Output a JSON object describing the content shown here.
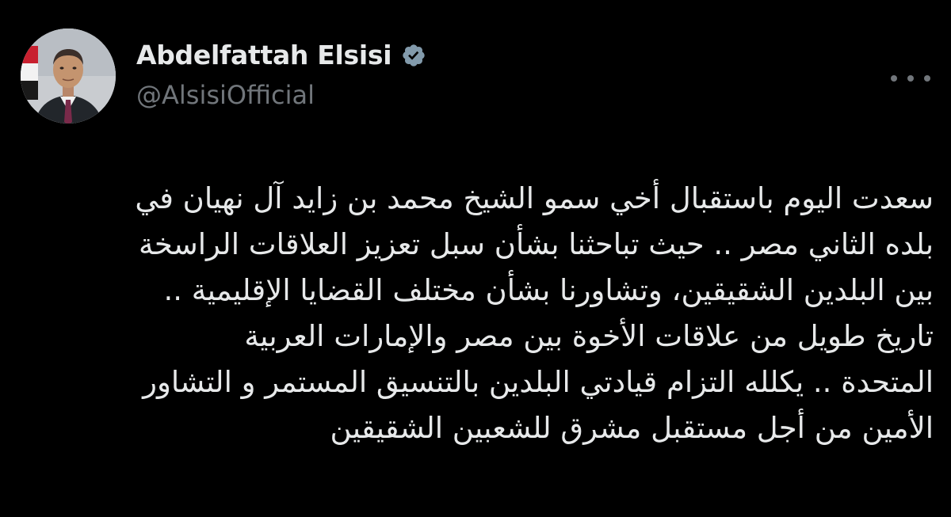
{
  "author": {
    "display_name": "Abdelfattah Elsisi",
    "handle": "@AlsisiOfficial",
    "verified_icon": "verified-badge-icon",
    "avatar": "profile-photo"
  },
  "menu": {
    "icon": "more-options-icon"
  },
  "tweet": {
    "lines": [
      "سعدت اليوم باستقبال أخي سمو الشيخ محمد بن زايد آل نهيان في",
      "بلده الثاني مصر .. حيث تباحثنا بشأن سبل تعزيز العلاقات الراسخة",
      "بين البلدين الشقيقين، وتشاورنا بشأن مختلف القضايا الإقليمية ..",
      "تاريخ طويل من علاقات الأخوة بين مصر والإمارات العربية",
      "المتحدة .. يكلله التزام قيادتي البلدين بالتنسيق المستمر و التشاور",
      "الأمين من أجل مستقبل مشرق للشعبين الشقيقين"
    ]
  },
  "colors": {
    "background": "#000000",
    "primary_text": "#e7e9ea",
    "secondary_text": "#71767b",
    "verified_badge": "#829aab"
  }
}
